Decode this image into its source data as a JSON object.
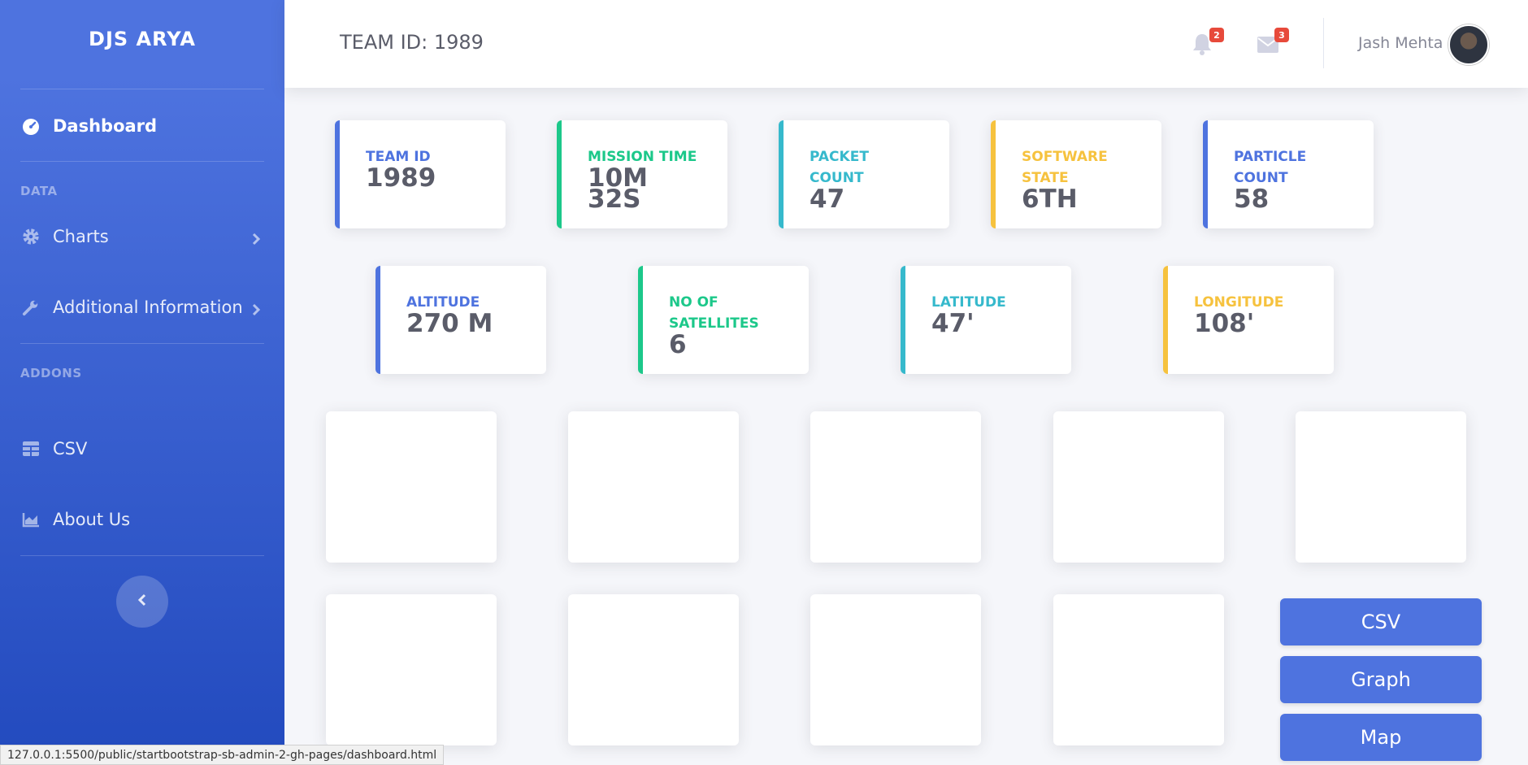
{
  "sidebar": {
    "brand": "DJS ARYA",
    "dashboard": "Dashboard",
    "heading_data": "DATA",
    "charts": "Charts",
    "additional": "Additional Information",
    "heading_addons": "ADDONS",
    "csv": "CSV",
    "about": "About Us"
  },
  "topbar": {
    "title": "TEAM ID: 1989",
    "alerts_count": "2",
    "messages_count": "3",
    "username": "Jash Mehta"
  },
  "cards": [
    {
      "label": "TEAM ID",
      "value": "1989"
    },
    {
      "label": "MISSION TIME",
      "value": "10m 32s"
    },
    {
      "label": "PACKET COUNT",
      "value": "47"
    },
    {
      "label": "SOFTWARE STATE",
      "value": "6th"
    },
    {
      "label": "PARTICLE COUNT",
      "value": "58"
    },
    {
      "label": "ALTITUDE",
      "value": "270 m"
    },
    {
      "label": "NO OF SATELLITES",
      "value": "6"
    },
    {
      "label": "LATITUDE",
      "value": "47'"
    },
    {
      "label": "LONGITUDE",
      "value": "108'"
    }
  ],
  "actions": {
    "csv": "CSV",
    "graph": "Graph",
    "map": "Map"
  },
  "status_url": "127.0.0.1:5500/public/startbootstrap-sb-admin-2-gh-pages/dashboard.html",
  "colors": {
    "primary": "#4e73df",
    "success": "#1cc88a",
    "info": "#36b9cc",
    "warning": "#f6c23e",
    "danger": "#e74a3b"
  }
}
